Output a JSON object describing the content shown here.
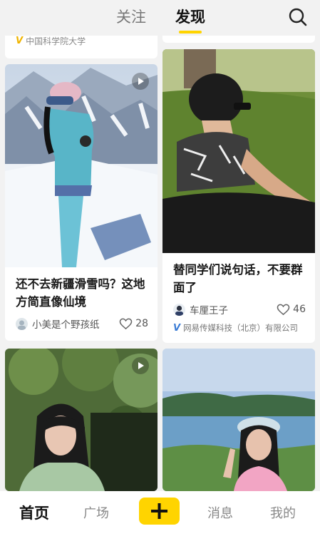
{
  "header": {
    "tabs": [
      {
        "label": "关注",
        "active": false
      },
      {
        "label": "发现",
        "active": true
      }
    ],
    "search_icon": "search-icon"
  },
  "feed": {
    "previous_left": {
      "source": "中国科学院大学",
      "badge": "V"
    },
    "cards": [
      {
        "title": "还不去新疆滑雪吗？这地方简直像仙境",
        "author": "小美是个野孩纸",
        "likes": "28",
        "has_video": true
      },
      {
        "title": "替同学们说句话，不要群面了",
        "author": "车厘王子",
        "likes": "46",
        "org_badge": "V",
        "org": "网易传媒科技（北京）有限公司",
        "has_video": false
      },
      {
        "has_video": true
      },
      {
        "has_video": false
      }
    ]
  },
  "bottom_nav": {
    "items": [
      {
        "label": "首页",
        "active": true
      },
      {
        "label": "广场",
        "active": false
      },
      {
        "label": "消息",
        "active": false
      },
      {
        "label": "我的",
        "active": false
      }
    ],
    "add_icon": "plus-icon"
  },
  "colors": {
    "accent": "#ffd400",
    "background": "#f2f2f2",
    "verified_org": "#3a7bd5",
    "verified_school": "#f0b400"
  }
}
